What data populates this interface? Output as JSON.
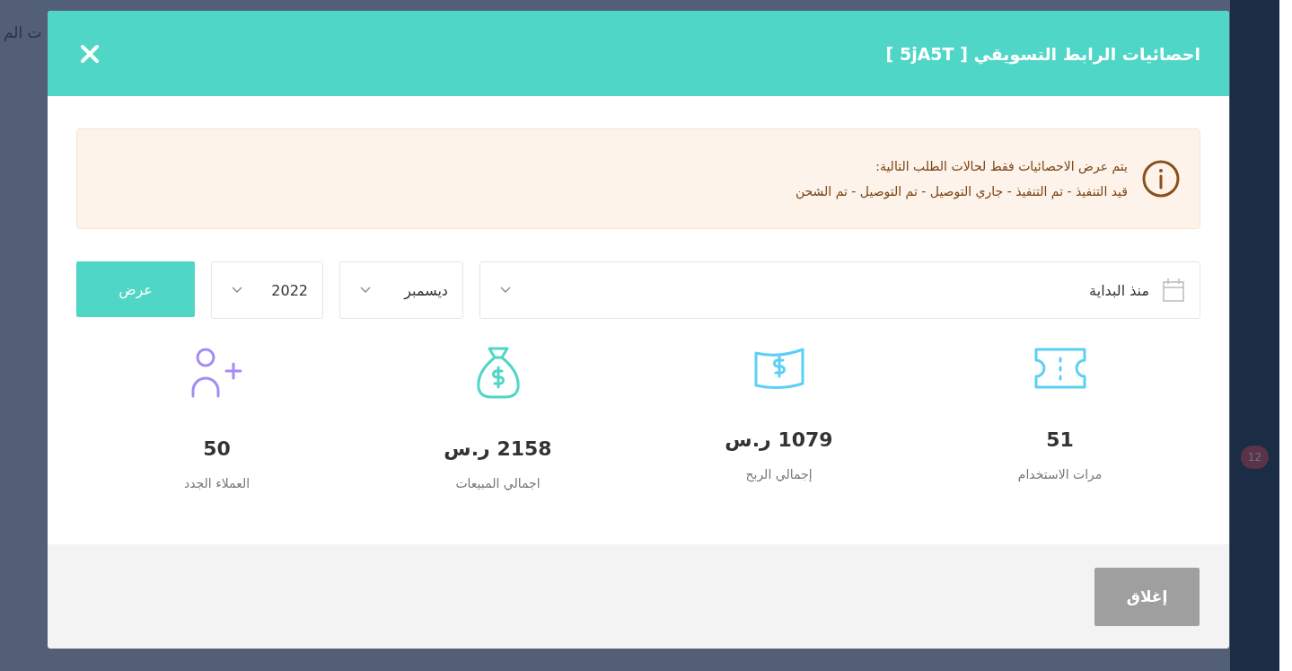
{
  "background": {
    "heading_fragment": "ت الم",
    "badge": "12"
  },
  "modal": {
    "title": "احصائيات الرابط التسويقي [ 5jA5T ]",
    "notice": {
      "line_1": "يتم عرض الاحصائيات فقط لحالات الطلب التالية:",
      "line_2": "قيد التنفيذ - تم التنفيذ - جاري التوصيل - تم التوصيل - تم الشحن"
    },
    "filters": {
      "period": "منذ البداية",
      "month": "ديسمبر",
      "year": "2022",
      "apply_button": "عرض"
    },
    "stats": [
      {
        "kind": "ticket",
        "color": "#5bd0f5",
        "value": "51",
        "label": "مرات الاستخدام"
      },
      {
        "kind": "bill",
        "color": "#5bd0f5",
        "value": "1079 ر.س",
        "label": "إجمالي الربح"
      },
      {
        "kind": "moneybag",
        "color": "#4fd6c7",
        "value": "2158 ر.س",
        "label": "اجمالي المبيعات"
      },
      {
        "kind": "user-plus",
        "color": "#a58cf5",
        "value": "50",
        "label": "العملاء الجدد"
      }
    ],
    "close_button": "إغلاق"
  }
}
